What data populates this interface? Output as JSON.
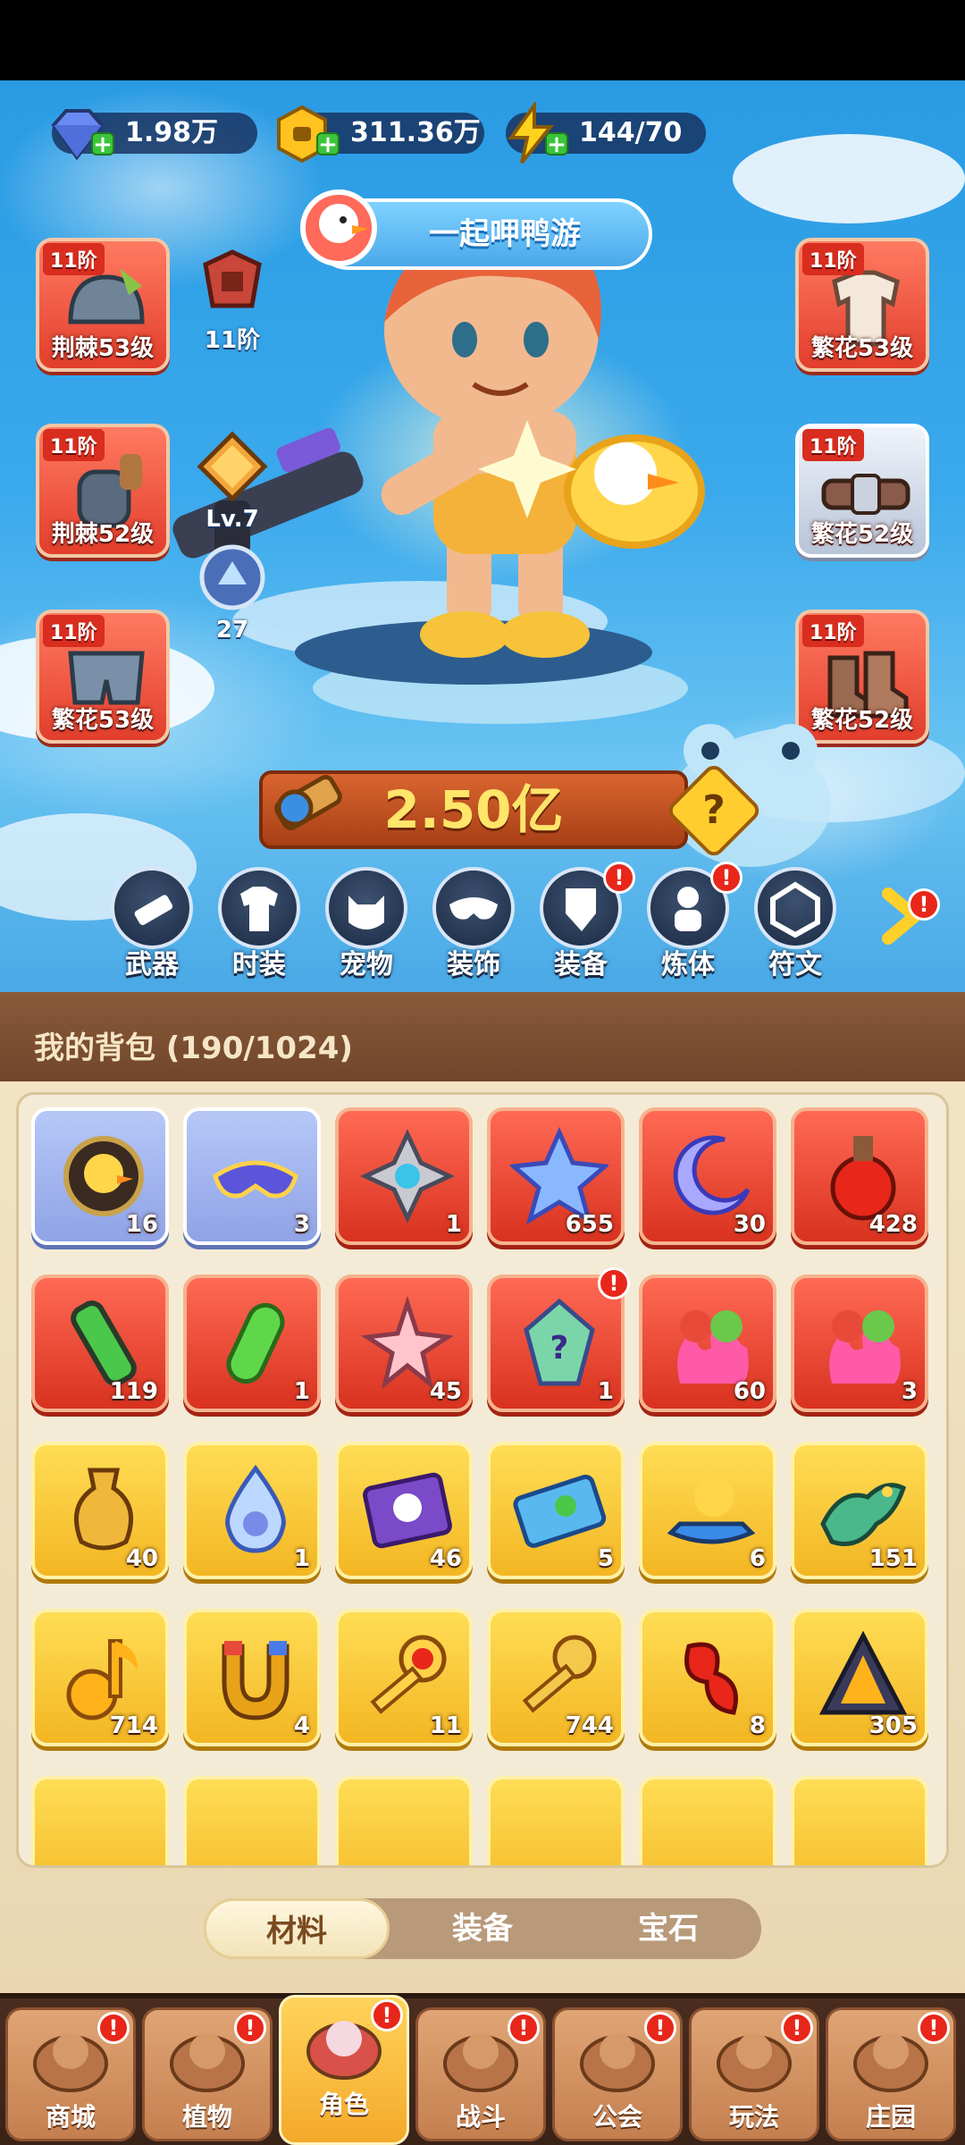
{
  "currencies": [
    {
      "name": "diamond-icon",
      "value": "1.98万"
    },
    {
      "name": "gold-coin-icon",
      "value": "311.36万"
    },
    {
      "name": "energy-icon",
      "value": "144/70"
    }
  ],
  "event": {
    "label": "一起呷鸭游"
  },
  "equipment_left": [
    {
      "tier": "11阶",
      "label": "荆棘53级"
    },
    {
      "tier": "11阶",
      "label": "荆棘52级"
    },
    {
      "tier": "11阶",
      "label": "繁花53级"
    }
  ],
  "equipment_right": [
    {
      "tier": "11阶",
      "label": "繁花53级"
    },
    {
      "tier": "11阶",
      "label": "繁花52级"
    },
    {
      "tier": "11阶",
      "label": "繁花52级"
    }
  ],
  "side_stats": {
    "emblem": "11阶",
    "rank": "Lv.7",
    "skill": "27"
  },
  "power": {
    "value": "2.50亿",
    "help": "?"
  },
  "features": [
    {
      "label": "武器",
      "badge": false
    },
    {
      "label": "时装",
      "badge": false
    },
    {
      "label": "宠物",
      "badge": false
    },
    {
      "label": "装饰",
      "badge": false
    },
    {
      "label": "装备",
      "badge": true
    },
    {
      "label": "炼体",
      "badge": true
    },
    {
      "label": "符文",
      "badge": false
    }
  ],
  "badge_text": "!",
  "bag": {
    "title": "我的背包 (190/1024)"
  },
  "items": [
    {
      "count": "16",
      "color": "blue",
      "icon": "duck-badge-icon"
    },
    {
      "count": "3",
      "color": "blue",
      "icon": "mask-icon"
    },
    {
      "count": "1",
      "color": "red",
      "icon": "compass-gear-icon"
    },
    {
      "count": "655",
      "color": "red",
      "icon": "star-crystal-icon"
    },
    {
      "count": "30",
      "color": "red",
      "icon": "moon-star-icon"
    },
    {
      "count": "428",
      "color": "red",
      "icon": "potion-icon"
    },
    {
      "count": "119",
      "color": "red",
      "icon": "tube-icon"
    },
    {
      "count": "1",
      "color": "red",
      "icon": "green-capsule-icon"
    },
    {
      "count": "45",
      "color": "red",
      "icon": "flower-shard-icon"
    },
    {
      "count": "1",
      "color": "red",
      "icon": "mystery-crystal-icon"
    },
    {
      "count": "60",
      "color": "red",
      "icon": "fire-heroes-icon"
    },
    {
      "count": "3",
      "color": "red",
      "icon": "fire-heroes-icon"
    },
    {
      "count": "40",
      "color": "gold",
      "icon": "gold-vase-icon"
    },
    {
      "count": "1",
      "color": "gold",
      "icon": "water-drop-icon"
    },
    {
      "count": "46",
      "color": "gold",
      "icon": "skull-ticket-icon"
    },
    {
      "count": "5",
      "color": "gold",
      "icon": "ticket-icon"
    },
    {
      "count": "6",
      "color": "gold",
      "icon": "jetski-duck-icon"
    },
    {
      "count": "151",
      "color": "gold",
      "icon": "dragon-icon"
    },
    {
      "count": "714",
      "color": "gold",
      "icon": "music-note-icon"
    },
    {
      "count": "4",
      "color": "gold",
      "icon": "magnet-icon"
    },
    {
      "count": "11",
      "color": "gold",
      "icon": "ruby-key-icon"
    },
    {
      "count": "744",
      "color": "gold",
      "icon": "gold-key-icon"
    },
    {
      "count": "8",
      "color": "gold",
      "icon": "red-ribbon-icon"
    },
    {
      "count": "305",
      "color": "gold",
      "icon": "pyramid-icon"
    }
  ],
  "bag_tabs": [
    "材料",
    "装备",
    "宝石"
  ],
  "nav": [
    {
      "label": "商城",
      "badge": true
    },
    {
      "label": "植物",
      "badge": true
    },
    {
      "label": "角色",
      "badge": true
    },
    {
      "label": "战斗",
      "badge": true
    },
    {
      "label": "公会",
      "badge": true
    },
    {
      "label": "玩法",
      "badge": true
    },
    {
      "label": "庄园",
      "badge": true
    }
  ],
  "colors": {
    "accent": "#f3b623",
    "red_slot": "#e23e2c",
    "panel": "#f4ebd6",
    "nav_bg": "#3a2217"
  }
}
